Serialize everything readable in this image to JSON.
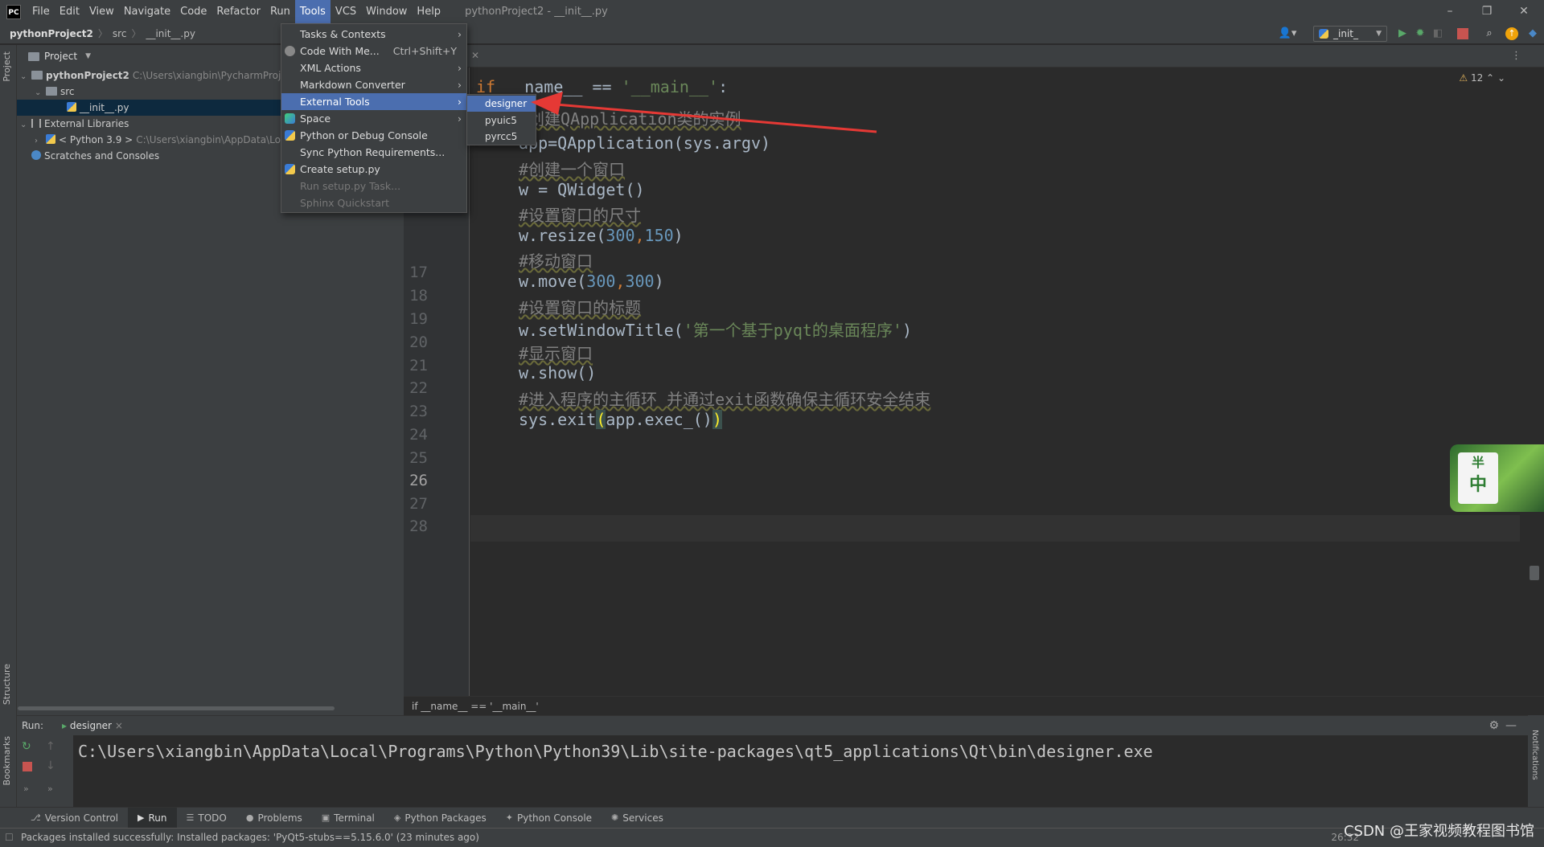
{
  "app": {
    "logo": "PC",
    "window_title": "pythonProject2 - __init__.py"
  },
  "menubar": {
    "items": [
      "File",
      "Edit",
      "View",
      "Navigate",
      "Code",
      "Refactor",
      "Run",
      "Tools",
      "VCS",
      "Window",
      "Help"
    ]
  },
  "window_controls": {
    "minimize": "–",
    "restore": "❐",
    "close": "✕"
  },
  "navbar": {
    "project": "pythonProject2",
    "folder": "src",
    "file": "__init__.py",
    "run_config": "_init_"
  },
  "project_panel": {
    "title": "Project",
    "tree": {
      "root": "pythonProject2",
      "root_path": "C:\\Users\\xiangbin\\PycharmProje",
      "src": "src",
      "init_file": "__init__.py",
      "external_libraries": "External Libraries",
      "python_sdk": "< Python 3.9 >",
      "python_sdk_path": "C:\\Users\\xiangbin\\AppData\\Lo",
      "scratches": "Scratches and Consoles"
    }
  },
  "left_strip": {
    "project": "Project",
    "structure": "Structure",
    "bookmarks": "Bookmarks"
  },
  "tools_menu": {
    "items": [
      {
        "label": "Tasks & Contexts",
        "submenu": true
      },
      {
        "label": "Code With Me...",
        "shortcut": "Ctrl+Shift+Y"
      },
      {
        "label": "XML Actions",
        "submenu": true
      },
      {
        "label": "Markdown Converter",
        "submenu": true
      },
      {
        "label": "External Tools",
        "submenu": true,
        "highlighted": true
      },
      {
        "label": "Space",
        "submenu": true
      },
      {
        "label": "Python or Debug Console"
      },
      {
        "label": "Sync Python Requirements..."
      },
      {
        "label": "Create setup.py"
      },
      {
        "label": "Run setup.py Task...",
        "disabled": true
      },
      {
        "label": "Sphinx Quickstart",
        "disabled": true
      }
    ]
  },
  "external_tools_menu": {
    "items": [
      "designer",
      "pyuic5",
      "pyrcc5"
    ]
  },
  "editor": {
    "inspection_count": "12",
    "gutter": {
      "lines": [
        "17",
        "18",
        "19",
        "20",
        "21",
        "22",
        "23",
        "24",
        "25",
        "26",
        "27",
        "28"
      ],
      "current_line": "26"
    },
    "code": {
      "line_main_kw": "if",
      "line_main_rest": " __name__ == ",
      "line_main_str": "'__main__'",
      "line_main_colon": ":",
      "comment_create_app": "#创建QApplication类的实例",
      "app_line": "app=QApplication(sys.argv)",
      "comment_create_window": "#创建一个窗口",
      "widget_line": "w = QWidget()",
      "comment_size": "#设置窗口的尺寸",
      "resize_prefix": "w.resize(",
      "resize_a": "300",
      "resize_comma": ",",
      "resize_b": "150",
      "resize_suffix": ")",
      "comment_move": "#移动窗口",
      "move_prefix": "w.move(",
      "move_a": "300",
      "move_comma": ",",
      "move_b": "300",
      "move_suffix": ")",
      "comment_title": "#设置窗口的标题",
      "title_prefix": "w.setWindowTitle(",
      "title_str": "'第一个基于pyqt的桌面程序'",
      "title_suffix": ")",
      "comment_show": "#显示窗口",
      "show_line": "w.show()",
      "comment_loop": "#进入程序的主循环 并通过exit函数确保主循环安全结束",
      "exit_prefix": "sys.exit",
      "exit_paren_open": "(",
      "exit_mid": "app.exec_()",
      "exit_paren_close": ")"
    },
    "breadcrumb": "if __name__ == '__main__'"
  },
  "run_panel": {
    "label": "Run:",
    "tab": "designer",
    "console": "C:\\Users\\xiangbin\\AppData\\Local\\Programs\\Python\\Python39\\Lib\\site-packages\\qt5_applications\\Qt\\bin\\designer.exe"
  },
  "right_strip": {
    "notifications": "Notifications"
  },
  "bottom_tools": [
    "Version Control",
    "Run",
    "TODO",
    "Problems",
    "Terminal",
    "Python Packages",
    "Python Console",
    "Services"
  ],
  "status": {
    "message": "Packages installed successfully: Installed packages: 'PyQt5-stubs==5.15.6.0' (23 minutes ago)",
    "position": "26:32"
  },
  "watermark": "CSDN @王家视频教程图书馆",
  "ime_badge": {
    "top": "半",
    "main": "中"
  },
  "colors": {
    "accent": "#4b6eaf",
    "keyword": "#cc7832",
    "string": "#6a8759",
    "number": "#6897bb",
    "arrow": "#e53935"
  }
}
